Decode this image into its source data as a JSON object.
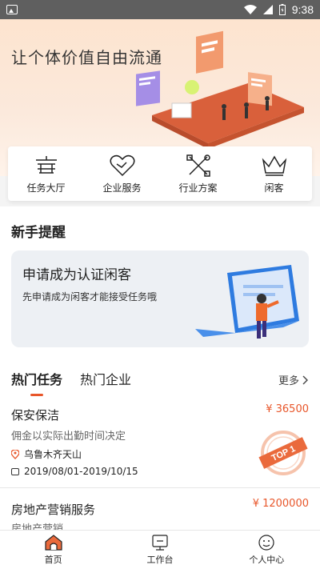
{
  "statusbar": {
    "time": "9:38"
  },
  "hero": {
    "title": "让个体价值自由流通"
  },
  "categories": [
    {
      "label": "任务大厅",
      "icon": "task-hall-icon"
    },
    {
      "label": "企业服务",
      "icon": "handshake-icon"
    },
    {
      "label": "行业方案",
      "icon": "tools-icon"
    },
    {
      "label": "闲客",
      "icon": "crown-icon"
    }
  ],
  "newbie": {
    "title": "新手提醒",
    "card_title": "申请成为认证闲客",
    "card_subtitle": "先申请成为闲客才能接受任务哦"
  },
  "tabs": [
    {
      "label": "热门任务",
      "active": true
    },
    {
      "label": "热门企业",
      "active": false
    }
  ],
  "more_label": "更多",
  "tasks": [
    {
      "title": "保安保洁",
      "price": "¥ 36500",
      "desc": "佣金以实际出勤时间决定",
      "location": "乌鲁木齐天山",
      "date": "2019/08/01-2019/10/15",
      "badge": "TOP 1"
    },
    {
      "title": "房地产营销服务",
      "price": "¥ 1200000",
      "desc": "房地产营销"
    }
  ],
  "bottomnav": [
    {
      "label": "首页",
      "icon": "home-icon"
    },
    {
      "label": "工作台",
      "icon": "workbench-icon"
    },
    {
      "label": "个人中心",
      "icon": "profile-icon"
    }
  ],
  "colors": {
    "accent": "#e8562a",
    "hero_bg": "#fde4cf"
  }
}
